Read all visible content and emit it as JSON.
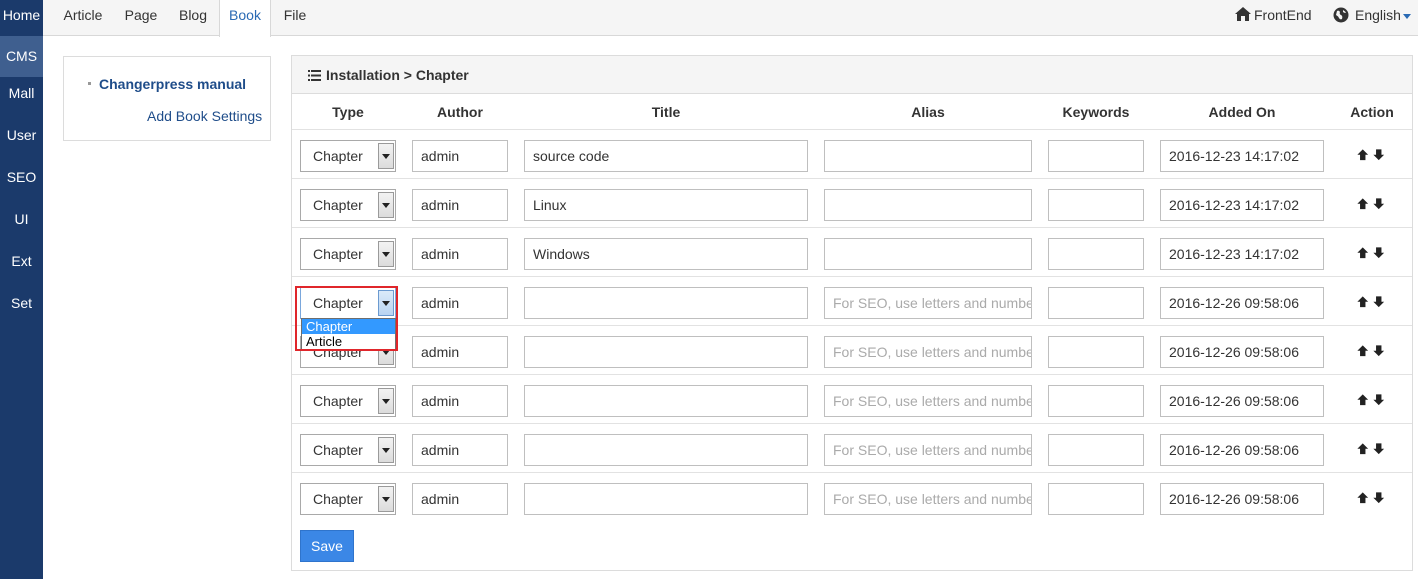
{
  "sidebar": {
    "items": [
      {
        "label": "Home",
        "active": false
      },
      {
        "label": "CMS",
        "active": true
      },
      {
        "label": "Mall",
        "active": false
      },
      {
        "label": "User",
        "active": false
      },
      {
        "label": "SEO",
        "active": false
      },
      {
        "label": "UI",
        "active": false
      },
      {
        "label": "Ext",
        "active": false
      },
      {
        "label": "Set",
        "active": false
      }
    ]
  },
  "topnav": {
    "tabs": [
      {
        "label": "Article",
        "active": false
      },
      {
        "label": "Page",
        "active": false
      },
      {
        "label": "Blog",
        "active": false
      },
      {
        "label": "Book",
        "active": true
      },
      {
        "label": "File",
        "active": false
      }
    ],
    "frontend_label": "FrontEnd",
    "language_label": "English"
  },
  "leftpanel": {
    "manual_label": "Changerpress manual",
    "add_settings_label": "Add Book Settings"
  },
  "panel": {
    "breadcrumb": "Installation > Chapter"
  },
  "table": {
    "headers": {
      "type": "Type",
      "author": "Author",
      "title": "Title",
      "alias": "Alias",
      "keywords": "Keywords",
      "added_on": "Added On",
      "action": "Action"
    },
    "alias_placeholder": "For SEO, use letters and numbers",
    "rows": [
      {
        "type": "Chapter",
        "author": "admin",
        "title": "source code",
        "alias": "",
        "keywords": "",
        "added_on": "2016-12-23 14:17:02"
      },
      {
        "type": "Chapter",
        "author": "admin",
        "title": "Linux",
        "alias": "",
        "keywords": "",
        "added_on": "2016-12-23 14:17:02"
      },
      {
        "type": "Chapter",
        "author": "admin",
        "title": "Windows",
        "alias": "",
        "keywords": "",
        "added_on": "2016-12-23 14:17:02"
      },
      {
        "type": "Chapter",
        "author": "admin",
        "title": "",
        "alias": "",
        "keywords": "",
        "added_on": "2016-12-26 09:58:06"
      },
      {
        "type": "Chapter",
        "author": "admin",
        "title": "",
        "alias": "",
        "keywords": "",
        "added_on": "2016-12-26 09:58:06"
      },
      {
        "type": "Chapter",
        "author": "admin",
        "title": "",
        "alias": "",
        "keywords": "",
        "added_on": "2016-12-26 09:58:06"
      },
      {
        "type": "Chapter",
        "author": "admin",
        "title": "",
        "alias": "",
        "keywords": "",
        "added_on": "2016-12-26 09:58:06"
      },
      {
        "type": "Chapter",
        "author": "admin",
        "title": "",
        "alias": "",
        "keywords": "",
        "added_on": "2016-12-26 09:58:06"
      }
    ]
  },
  "dropdown": {
    "options": [
      "Chapter",
      "Article"
    ],
    "highlighted": "Chapter"
  },
  "save_label": "Save",
  "icons": {
    "home": "home-icon",
    "globe": "globe-icon",
    "list": "list-icon",
    "up": "arrow-up-icon",
    "down": "arrow-down-icon"
  },
  "colors": {
    "sidebar": "#1b3a6b",
    "accent": "#3b87e6",
    "link": "#1f4d8a",
    "highlight_box": "#e0262b"
  }
}
